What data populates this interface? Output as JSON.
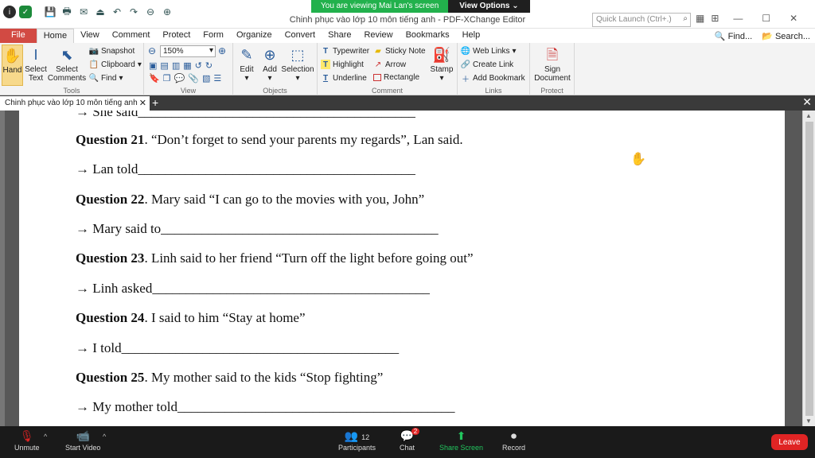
{
  "window": {
    "title": "Chinh phục vào lớp 10 môn tiếng anh - PDF-XChange Editor",
    "quick_launch_placeholder": "Quick Launch (Ctrl+.)"
  },
  "share_banner": {
    "viewing": "You are viewing Mai Lan's screen",
    "view_options": "View Options ⌄"
  },
  "ribbon_tabs": [
    "File",
    "Home",
    "View",
    "Comment",
    "Protect",
    "Form",
    "Organize",
    "Convert",
    "Share",
    "Review",
    "Bookmarks",
    "Help"
  ],
  "ribbon_right": {
    "find": "Find...",
    "search": "Search..."
  },
  "ribbon": {
    "tools": {
      "label": "Tools",
      "hand": "Hand",
      "select_text": "Select\nText",
      "select_comments": "Select\nComments",
      "snapshot": "Snapshot",
      "clipboard": "Clipboard",
      "find": "Find"
    },
    "view": {
      "label": "View",
      "zoom": "150%"
    },
    "objects": {
      "label": "Objects",
      "edit": "Edit",
      "add": "Add",
      "selection": "Selection"
    },
    "comment": {
      "label": "Comment",
      "typewriter": "Typewriter",
      "sticky_note": "Sticky Note",
      "highlight": "Highlight",
      "arrow": "Arrow",
      "underline": "Underline",
      "rectangle": "Rectangle",
      "stamp": "Stamp"
    },
    "links": {
      "label": "Links",
      "web_links": "Web Links",
      "create_link": "Create Link",
      "add_bookmark": "Add Bookmark"
    },
    "protect": {
      "label": "Protect",
      "sign_document": "Sign\nDocument"
    }
  },
  "doc_tab": {
    "title": "Chinh phục vào lớp 10 môn tiếng anh"
  },
  "document": {
    "lines": [
      {
        "q": "",
        "text": "→ She said_________________________________________"
      },
      {
        "q": "Question 21",
        "text": ". “Don’t forget to send your parents my regards”, Lan said."
      },
      {
        "q": "",
        "text": "→ Lan told_________________________________________"
      },
      {
        "q": "Question 22",
        "text": ". Mary said “I can go to the movies with you, John”"
      },
      {
        "q": "",
        "text": "→ Mary said to_________________________________________"
      },
      {
        "q": "Question 23",
        "text": ". Linh said to her friend “Turn off the light before going out”"
      },
      {
        "q": "",
        "text": "→ Linh asked_________________________________________"
      },
      {
        "q": "Question 24",
        "text": ". I said to him “Stay at home”"
      },
      {
        "q": "",
        "text": "→ I told_________________________________________"
      },
      {
        "q": "Question 25",
        "text": ". My mother said to the kids “Stop fighting”"
      },
      {
        "q": "",
        "text": "→ My mother told_________________________________________"
      }
    ]
  },
  "zoom_bar": {
    "unmute": "Unmute",
    "start_video": "Start Video",
    "participants": "Participants",
    "participants_count": "12",
    "chat": "Chat",
    "chat_badge": "2",
    "share_screen": "Share Screen",
    "record": "Record",
    "leave": "Leave"
  }
}
